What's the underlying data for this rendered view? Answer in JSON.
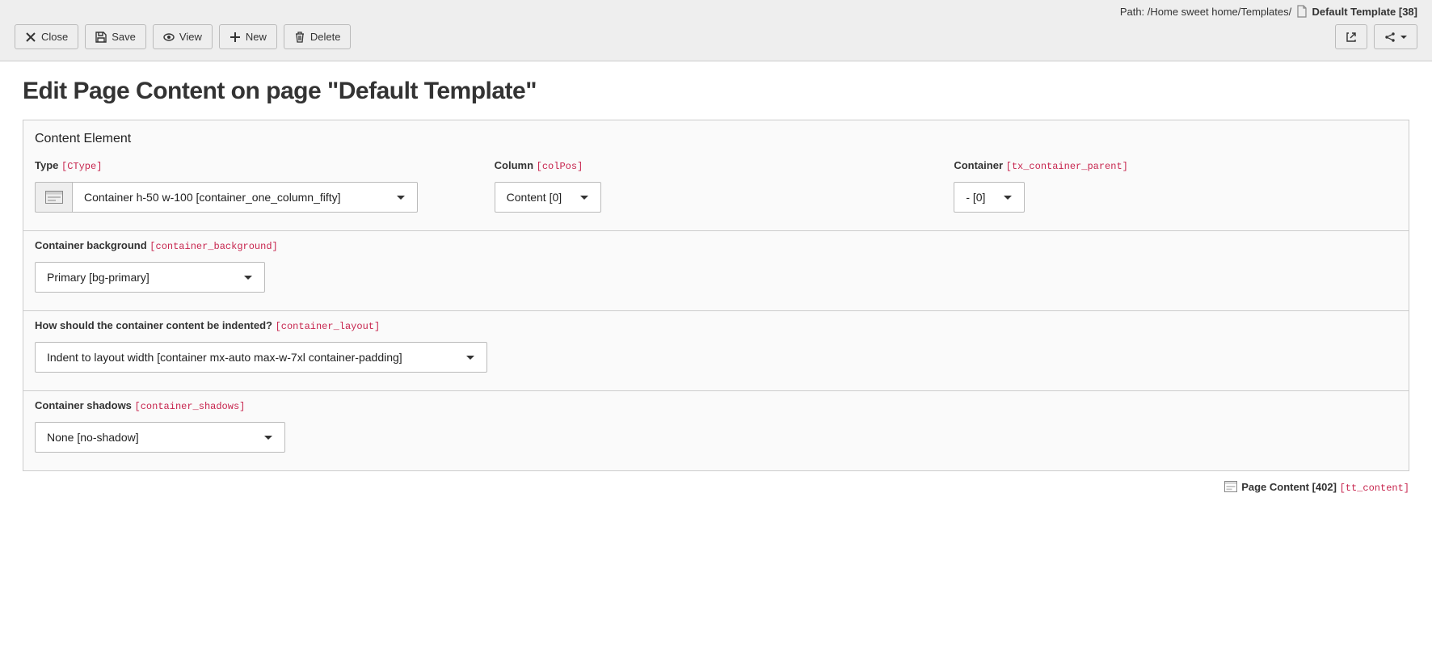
{
  "toolbar": {
    "path_prefix": "Path: /Home sweet home/Templates/ ",
    "path_bold": "Default Template [38]",
    "close": "Close",
    "save": "Save",
    "view": "View",
    "new": "New",
    "delete": "Delete"
  },
  "heading": "Edit Page Content on page \"Default Template\"",
  "panel": {
    "content_element": "Content Element",
    "type": {
      "label": "Type ",
      "tech": "[CType]",
      "value": "Container h-50 w-100 [container_one_column_fifty]"
    },
    "column": {
      "label": "Column ",
      "tech": "[colPos]",
      "value": "Content [0]"
    },
    "container": {
      "label": "Container ",
      "tech": "[tx_container_parent]",
      "value": "- [0]"
    },
    "bg": {
      "label": "Container background ",
      "tech": "[container_background]",
      "value": "Primary [bg-primary]"
    },
    "layout": {
      "label": "How should the container content be indented? ",
      "tech": "[container_layout]",
      "value": "Indent to layout width [container mx-auto max-w-7xl container-padding]"
    },
    "shadows": {
      "label": "Container shadows ",
      "tech": "[container_shadows]",
      "value": "None [no-shadow]"
    }
  },
  "footer": {
    "bold": "Page Content [402]",
    "tech": "[tt_content]"
  }
}
